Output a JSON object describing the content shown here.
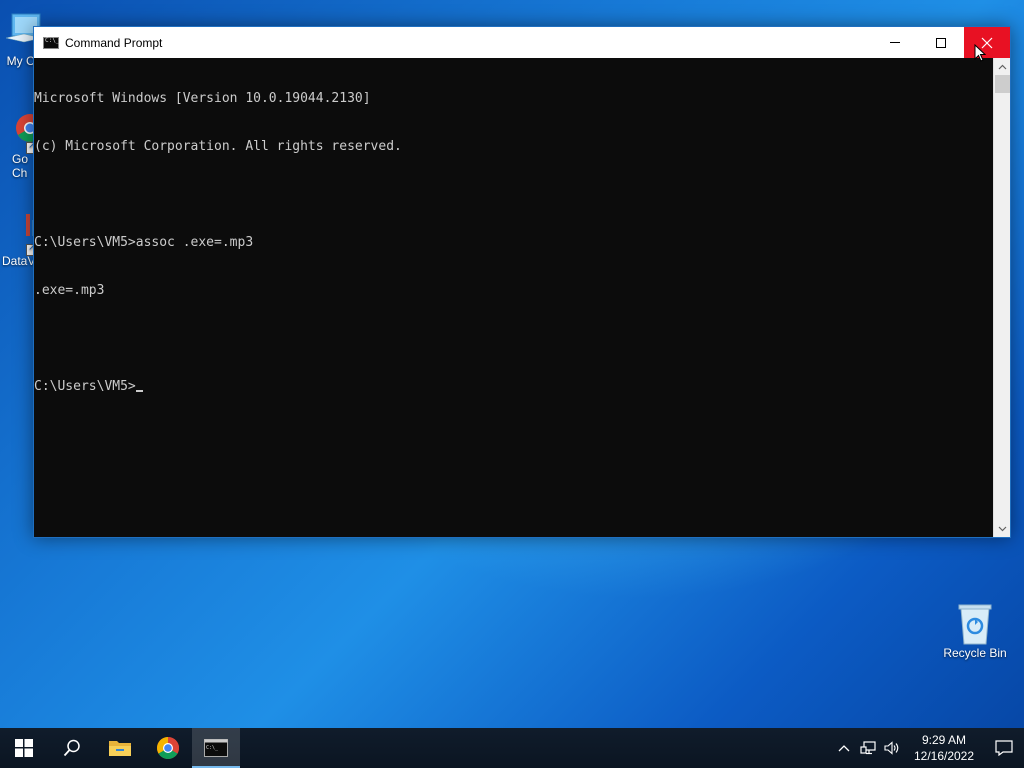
{
  "desktop": {
    "icons": [
      {
        "label": "My Co"
      },
      {
        "label": "Go\nCh"
      },
      {
        "label": "DataV"
      },
      {
        "label": "Recycle Bin"
      }
    ]
  },
  "window": {
    "title": "Command Prompt",
    "icon": "cmd-icon",
    "controls": {
      "minimize": "minimize-icon",
      "maximize": "maximize-icon",
      "close": "×"
    },
    "console_lines": [
      "Microsoft Windows [Version 10.0.19044.2130]",
      "(c) Microsoft Corporation. All rights reserved.",
      "",
      "C:\\Users\\VM5>assoc .exe=.mp3",
      ".exe=.mp3",
      "",
      "C:\\Users\\VM5>"
    ],
    "text_color": "#cccccc",
    "background_color": "#0c0c0c",
    "close_hover_color": "#e81123"
  },
  "taskbar": {
    "items": [
      {
        "name": "start",
        "icon": "windows-logo-icon"
      },
      {
        "name": "search",
        "icon": "search-icon"
      },
      {
        "name": "file-explorer",
        "icon": "folder-icon"
      },
      {
        "name": "chrome",
        "icon": "chrome-icon"
      },
      {
        "name": "command-prompt",
        "icon": "cmd-icon",
        "active": true
      }
    ],
    "tray": {
      "chevron": "^",
      "time": "9:29 AM",
      "date": "12/16/2022"
    }
  }
}
